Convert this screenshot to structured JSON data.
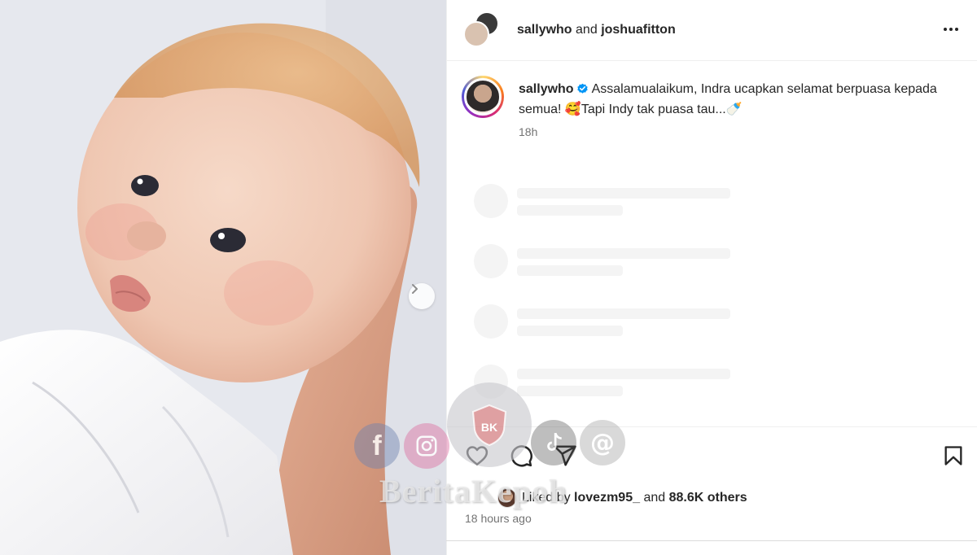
{
  "post_header": {
    "user1": "sallywho",
    "connector": "and",
    "user2": "joshuafitton",
    "more_icon": "more-horizontal-icon"
  },
  "caption": {
    "username": "sallywho",
    "verified_icon": "verified-badge-icon",
    "text": "Assalamualaikum, Indra ucapkan selamat berpuasa kepada semua! 🥰Tapi Indy tak puasa tau...🍼",
    "time": "18h"
  },
  "media": {
    "next_icon": "chevron-right-icon"
  },
  "actions": {
    "like_icon": "heart-icon",
    "comment_icon": "comment-icon",
    "share_icon": "send-icon",
    "save_icon": "bookmark-icon",
    "liked_by_prefix": "Liked by",
    "liked_by_user": "lovezm95_",
    "liked_by_and": "and",
    "liked_by_others": "88.6K others",
    "time_ago": "18 hours ago"
  },
  "watermark": {
    "text": "BeritaKepoh",
    "badge_text": "BK"
  },
  "colors": {
    "text": "#262626",
    "secondary": "#737373",
    "verified": "#0095f6",
    "border": "#efefef"
  }
}
